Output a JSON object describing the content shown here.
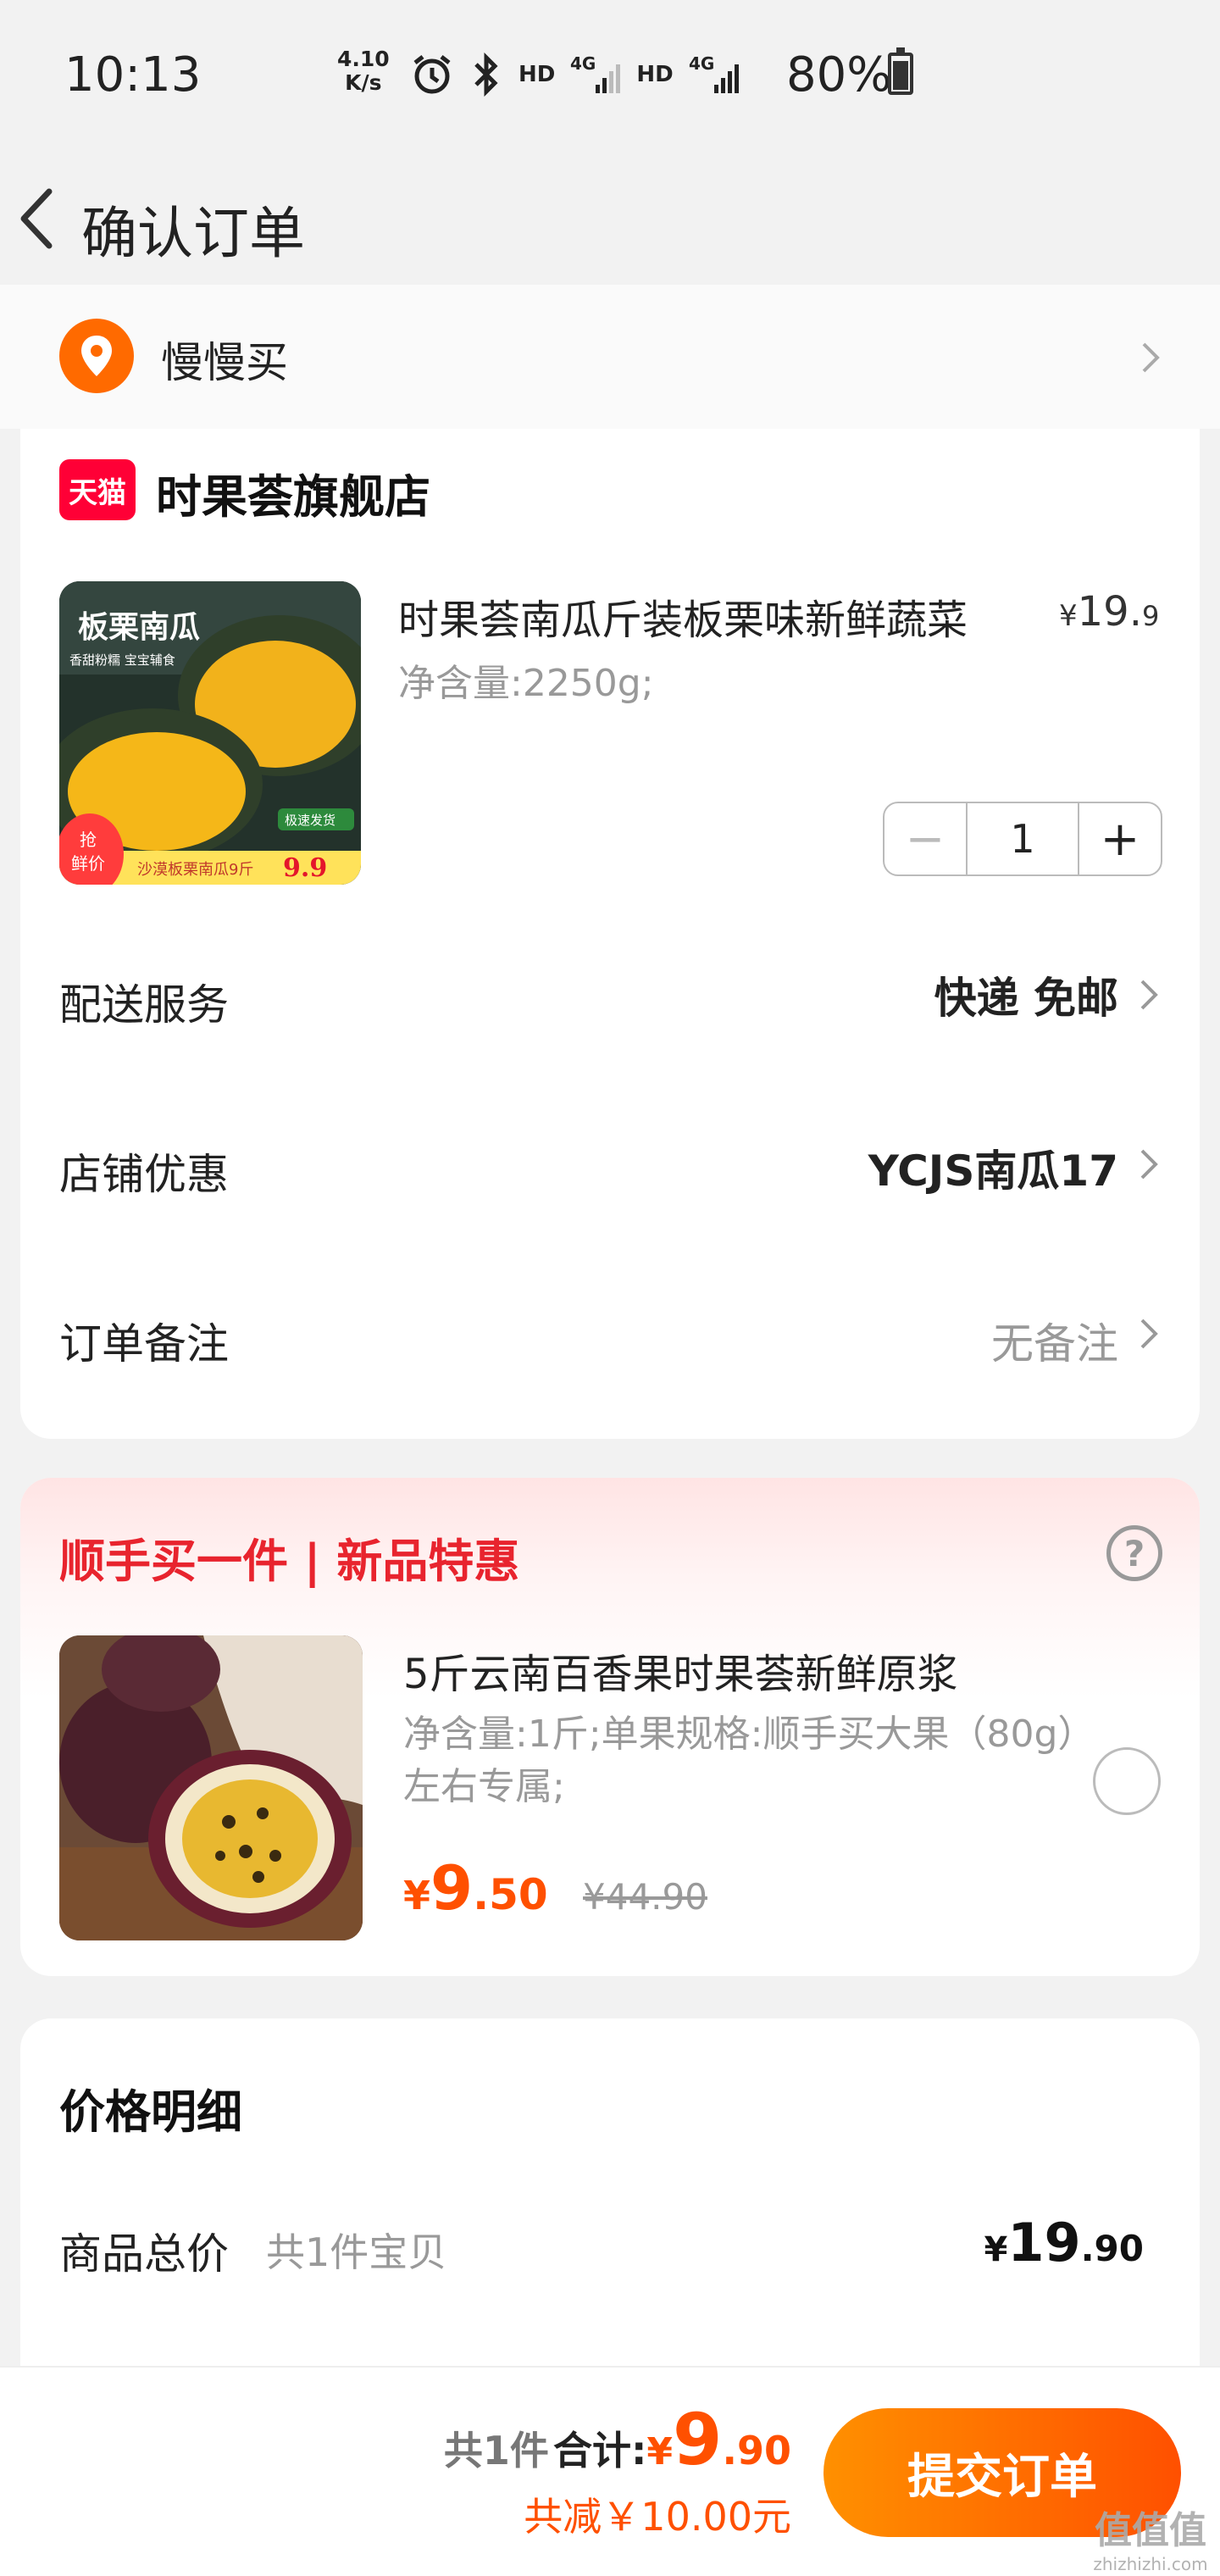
{
  "status_bar": {
    "time": "10:13",
    "net_speed_value": "4.10",
    "net_speed_unit": "K/s",
    "hd1": "HD",
    "hd2": "HD",
    "network1": "4G",
    "network2": "4G",
    "battery": "80%"
  },
  "nav": {
    "title": "确认订单",
    "back_icon": "chevron-left-icon"
  },
  "address": {
    "text": "慢慢买",
    "icon": "location-pin-icon"
  },
  "shop": {
    "badge": "天猫",
    "name": "时果荟旗舰店",
    "product": {
      "title": "时果荟南瓜斤装板栗味新鲜蔬菜",
      "price_currency": "¥",
      "price_int": "19.",
      "price_dec": "9",
      "spec": "净含量:2250g;",
      "quantity": "1",
      "image_text_top": "板栗南瓜",
      "image_text_sub": "香甜粉糯 宝宝辅食",
      "image_tag": "极速发货",
      "image_badge_top": "抢",
      "image_badge_bottom": "鲜价",
      "image_bottom_text": "沙漠板栗南瓜9斤",
      "image_bottom_price": "9.9"
    },
    "rows": [
      {
        "label": "配送服务",
        "value": "快递 免邮"
      },
      {
        "label": "店铺优惠",
        "value": "YCJS南瓜17"
      },
      {
        "label": "订单备注",
        "value": "无备注"
      }
    ]
  },
  "addon": {
    "title": "顺手买一件 | 新品特惠",
    "name": "5斤云南百香果时果荟新鲜原浆",
    "spec": "净含量:1斤;单果规格:顺手买大果（80g）左右专属;",
    "price_currency": "¥",
    "price_int": "9",
    "price_dec": ".50",
    "original_price": "¥44.90"
  },
  "price_detail": {
    "title": "价格明细",
    "label": "商品总价",
    "sub": "共1件宝贝",
    "currency": "¥",
    "int": "19",
    "dec": ".90"
  },
  "bottom_bar": {
    "count": "共1件",
    "total_label": "合计:",
    "currency": "¥",
    "total_int": "9",
    "total_dec": ".90",
    "discount": "共减￥10.00元",
    "submit": "提交订单"
  },
  "watermark": {
    "line1": "值值值",
    "line2": "zhizhizhi.com"
  },
  "colors": {
    "accent": "#ff5000",
    "red": "#e8242e",
    "tmall": "#ff0036"
  }
}
